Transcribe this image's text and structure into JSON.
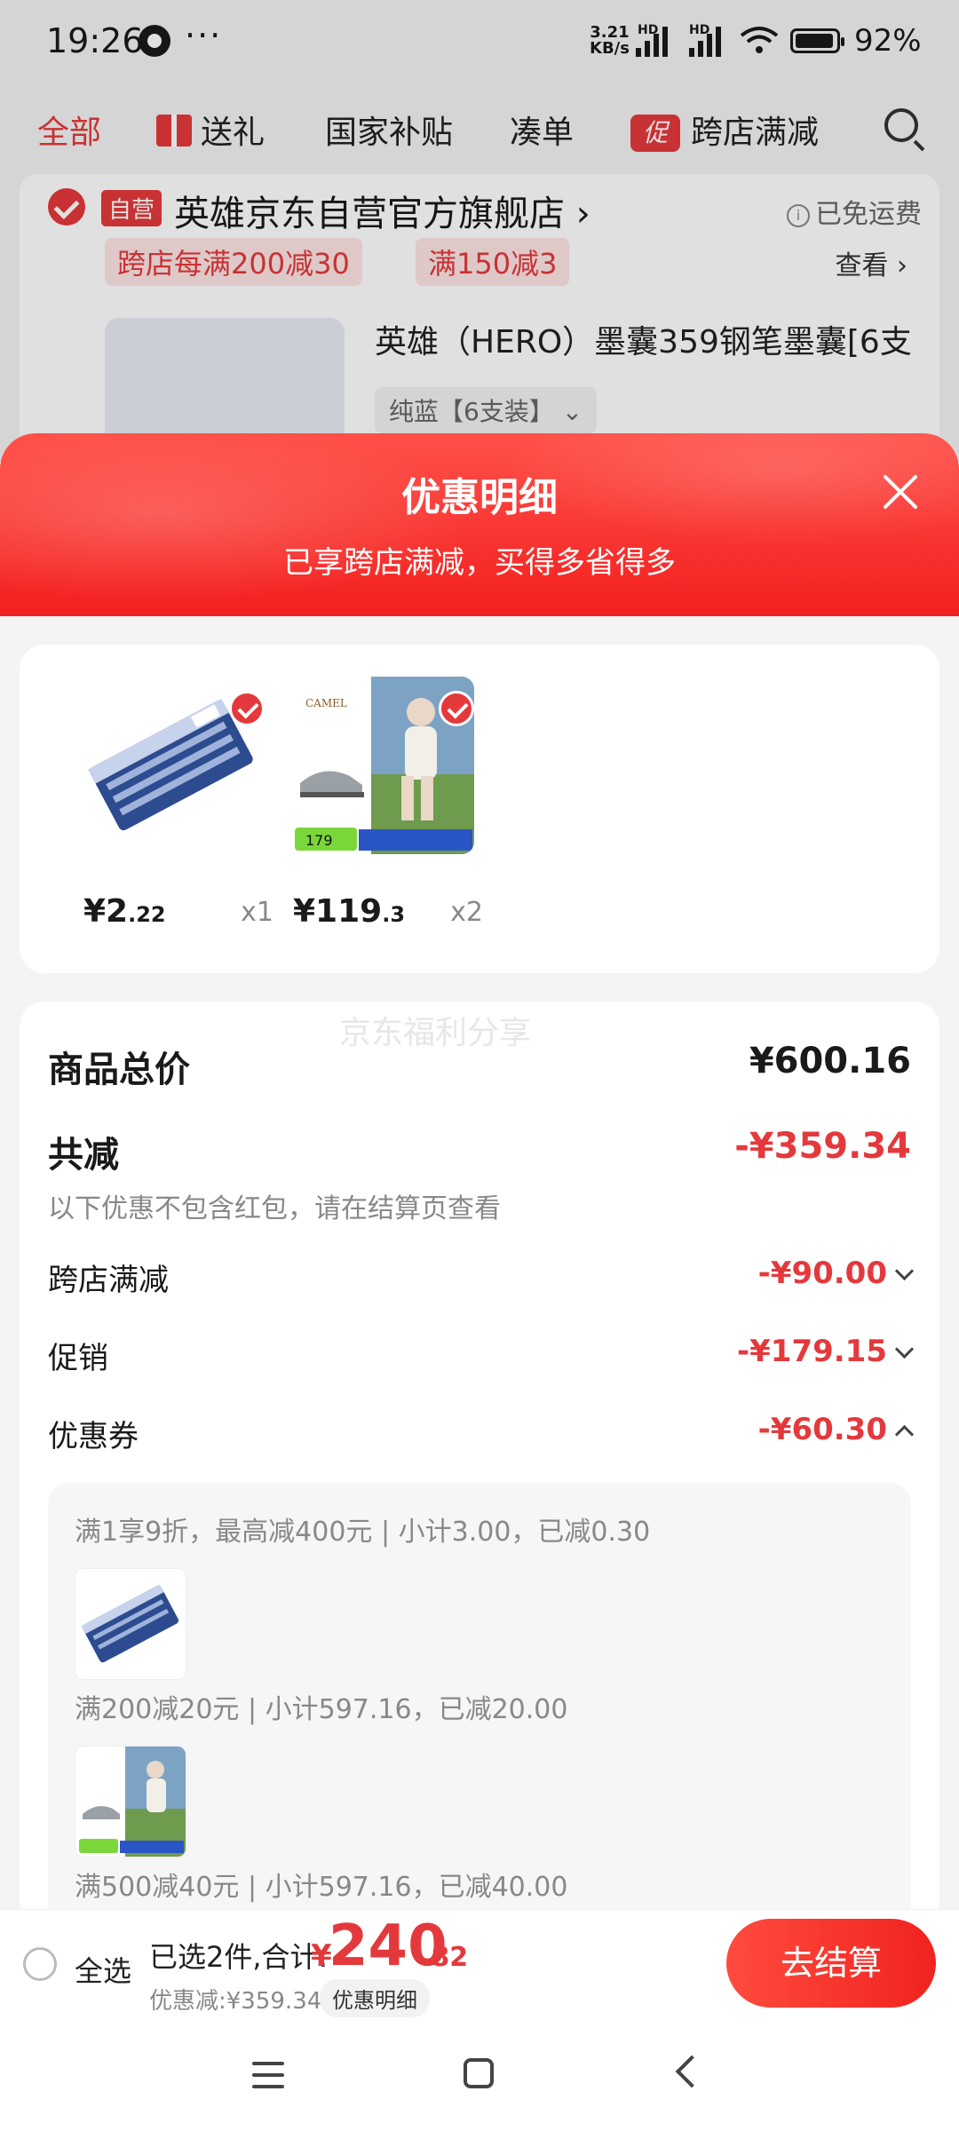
{
  "status_bar": {
    "time": "19:26",
    "more": "···",
    "net_speed_top": "3.21",
    "net_speed_bottom": "KB/s",
    "hd": "HD",
    "battery_pct": "92%"
  },
  "top_nav": {
    "tabs": [
      "全部",
      "送礼",
      "国家补贴",
      "凑单",
      "跨店满减"
    ],
    "promo_badge": "促"
  },
  "store": {
    "self_badge": "自营",
    "name": "英雄京东自营官方旗舰店 ›",
    "free_shipping": "已免运费",
    "tags": [
      "跨店每满200减30",
      "满150减3"
    ],
    "view_link": "查看 ›",
    "product_title": "英雄（HERO）墨囊359钢笔墨囊[6支",
    "product_spec": "纯蓝【6支装】 ⌄"
  },
  "sheet": {
    "title": "优惠明细",
    "subtitle": "已享跨店满减，买得多省得多"
  },
  "items": [
    {
      "price_int": "¥2",
      "price_dec": ".22",
      "qty": "x1"
    },
    {
      "price_int": "¥119",
      "price_dec": ".3",
      "qty": "x2",
      "brand": "CAMEL",
      "img_price": "179"
    }
  ],
  "watermark": "京东福利分享",
  "summary": {
    "total_label": "商品总价",
    "total_value": "¥600.16",
    "reduce_label": "共减",
    "reduce_value": "-¥359.34",
    "note": "以下优惠不包含红包，请在结算页查看",
    "rows": [
      {
        "label": "跨店满减",
        "value": "-¥90.00"
      },
      {
        "label": "促销",
        "value": "-¥179.15"
      },
      {
        "label": "优惠券",
        "value": "-¥60.30"
      }
    ]
  },
  "coupons": [
    "满1享9折，最高减400元 | 小计3.00，已减0.30",
    "满200减20元 | 小计597.16，已减20.00",
    "满500减40元 | 小计597.16，已减40.00"
  ],
  "checkout": {
    "select_all": "全选",
    "selected_text": "已选2件,合计:",
    "currency": "¥",
    "total_int": "240",
    "total_dec": ".82",
    "discount_text": "优惠减:¥359.34",
    "detail_btn": "优惠明细",
    "checkout_btn": "去结算"
  },
  "colors": {
    "accent": "#e4393c",
    "sheet_header": "#f3201f"
  }
}
